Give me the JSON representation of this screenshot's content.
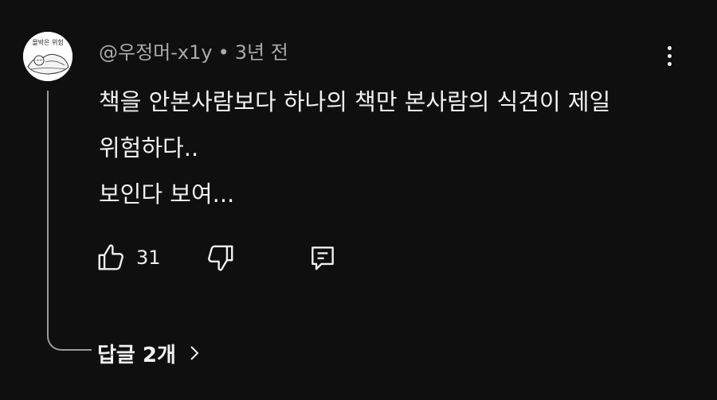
{
  "comment": {
    "author": "@우정머-x1y",
    "separator": "•",
    "time": "3년 전",
    "lines": [
      "책을 안본사람보다 하나의 책만 본사람의 식견이 제일",
      "위험하다..",
      "보인다 보여..."
    ],
    "likes": "31",
    "avatar_text": "몰박은 위험"
  },
  "actions": {
    "like_icon": "thumbs-up-icon",
    "dislike_icon": "thumbs-down-icon",
    "reply_icon": "reply-comment-icon",
    "more_icon": "more-vertical-icon"
  },
  "replies": {
    "label": "답글 2개",
    "chevron_icon": "chevron-right-icon"
  },
  "colors": {
    "background": "#0f0f0f",
    "text": "#f1f1f1",
    "secondary_text": "#aaaaaa"
  }
}
